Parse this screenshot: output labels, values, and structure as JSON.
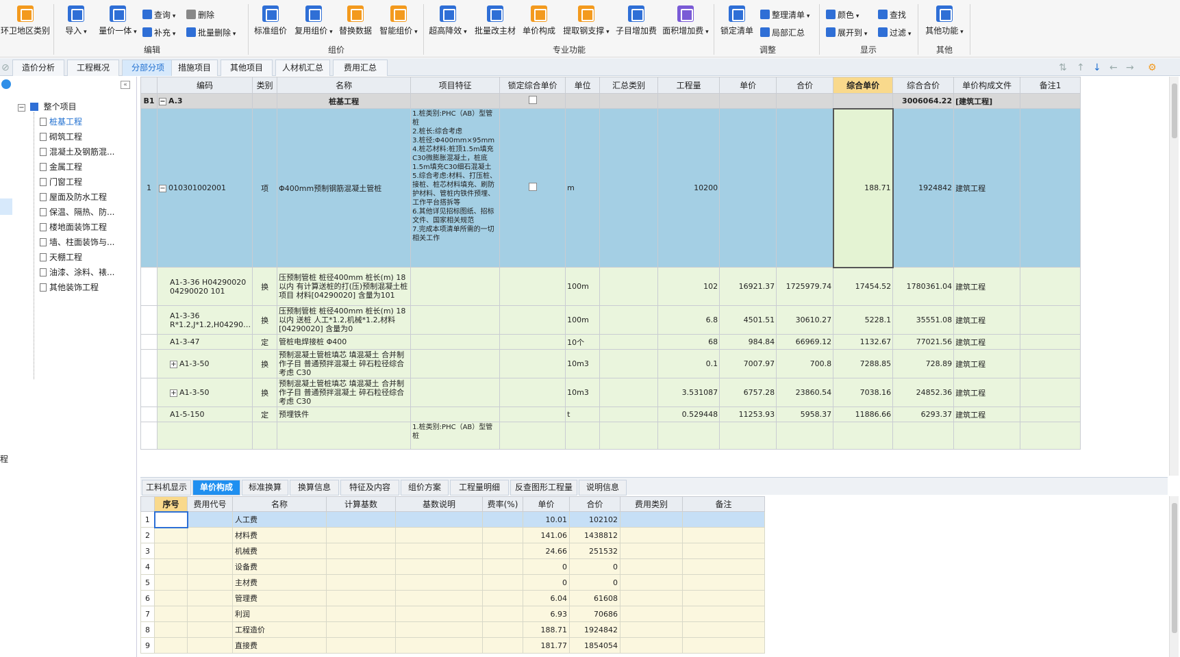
{
  "ribbon": {
    "big_buttons": [
      {
        "label": "环卫地区类别",
        "icon": "region-category-icon"
      },
      {
        "label": "导入",
        "icon": "import-icon"
      },
      {
        "label": "量价一体",
        "icon": "quantity-price-icon"
      },
      {
        "label": "标准组价",
        "icon": "standard-pricing-icon"
      },
      {
        "label": "复用组价",
        "icon": "reuse-pricing-icon"
      },
      {
        "label": "替换数据",
        "icon": "replace-data-icon"
      },
      {
        "label": "智能组价",
        "icon": "smart-pricing-icon"
      },
      {
        "label": "超高降效",
        "icon": "super-height-icon"
      },
      {
        "label": "批量改主材",
        "icon": "batch-material-icon"
      },
      {
        "label": "单价构成",
        "icon": "unit-price-icon"
      },
      {
        "label": "提取钢支撑",
        "icon": "steel-support-icon"
      },
      {
        "label": "子目增加费",
        "icon": "sub-item-fee-icon"
      },
      {
        "label": "面积增加费",
        "icon": "area-fee-icon"
      },
      {
        "label": "锁定清单",
        "icon": "lock-list-icon"
      },
      {
        "label": "其他功能",
        "icon": "other-functions-icon"
      }
    ],
    "small_buttons": {
      "query": "查询",
      "delete": "删除",
      "supplement": "补充",
      "batch_delete": "批量删除",
      "organize_list": "整理清单",
      "partial_summary": "局部汇总",
      "color": "颜色",
      "find": "查找",
      "expand_to": "展开到",
      "filter": "过滤"
    },
    "groups": {
      "edit": "编辑",
      "pricing": "组价",
      "professional": "专业功能",
      "adjust": "调整",
      "display": "显示",
      "other": "其他"
    }
  },
  "tabs": [
    "造价分析",
    "工程概况",
    "分部分项",
    "措施项目",
    "其他项目",
    "人材机汇总",
    "费用汇总"
  ],
  "active_tab": "分部分项",
  "tree": {
    "root": "整个项目",
    "items": [
      "桩基工程",
      "砌筑工程",
      "混凝土及钢筋混...",
      "金属工程",
      "门窗工程",
      "屋面及防水工程",
      "保温、隔热、防...",
      "楼地面装饰工程",
      "墙、柱面装饰与...",
      "天棚工程",
      "油漆、涂料、裱...",
      "其他装饰工程"
    ],
    "selected": "桩基工程",
    "left_edge_label": "程"
  },
  "grid": {
    "columns": [
      "编码",
      "类别",
      "名称",
      "项目特征",
      "锁定综合单价",
      "单位",
      "汇总类别",
      "工程量",
      "单价",
      "合价",
      "综合单价",
      "综合合价",
      "单价构成文件",
      "备注1"
    ],
    "section": {
      "row_no": "B1",
      "code": "A.3",
      "name": "桩基工程",
      "total": "3006064.22",
      "file": "[建筑工程]"
    },
    "main_row": {
      "row_no": "1",
      "code": "010301002001",
      "type": "项",
      "name": "Φ400mm预制钢筋混凝土管桩",
      "feature": "1.桩类别:PHC（AB）型管桩\n2.桩长:综合考虑\n3.桩径:Φ400mm×95mm\n4.桩芯材料:桩顶1.5m填充C30微膨胀混凝土，桩底1.5m填充C30细石混凝土\n5.综合考虑:材料、打压桩、接桩、桩芯材料填充、刷防护材料、管桩内铁件预埋、工作平台搭拆等\n6.其他详见招标图纸、招标文件、国家相关规范\n7.完成本项清单所需的一切相关工作",
      "unit": "m",
      "quantity": "10200",
      "composite_price": "188.71",
      "composite_total": "1924842",
      "file": "建筑工程"
    },
    "sub_rows": [
      {
        "code": "A1-3-36 H04290020 04290020 101",
        "type": "换",
        "name": "压预制管桩 桩径400mm 桩长(m) 18以内  有计算送桩的打(压)预制混凝土桩项目 材料[04290020] 含量为101",
        "unit": "100m",
        "quantity": "102",
        "price": "16921.37",
        "total": "1725979.74",
        "composite_price": "17454.52",
        "composite_total": "1780361.04",
        "file": "建筑工程",
        "expander": ""
      },
      {
        "code": "A1-3-36 R*1.2,J*1.2,H04290…",
        "type": "换",
        "name": "压预制管桩 桩径400mm 桩长(m) 18以内  送桩 人工*1.2,机械*1.2,材料[04290020] 含量为0",
        "unit": "100m",
        "quantity": "6.8",
        "price": "4501.51",
        "total": "30610.27",
        "composite_price": "5228.1",
        "composite_total": "35551.08",
        "file": "建筑工程",
        "expander": ""
      },
      {
        "code": "A1-3-47",
        "type": "定",
        "name": "管桩电焊接桩 Φ400",
        "unit": "10个",
        "quantity": "68",
        "price": "984.84",
        "total": "66969.12",
        "composite_price": "1132.67",
        "composite_total": "77021.56",
        "file": "建筑工程",
        "expander": ""
      },
      {
        "code": "A1-3-50",
        "type": "换",
        "name": "预制混凝土管桩填芯 填混凝土  合并制作子目 普通预拌混凝土 碎石粒径综合考虑 C30",
        "unit": "10m3",
        "quantity": "0.1",
        "price": "7007.97",
        "total": "700.8",
        "composite_price": "7288.85",
        "composite_total": "728.89",
        "file": "建筑工程",
        "expander": "+"
      },
      {
        "code": "A1-3-50",
        "type": "换",
        "name": "预制混凝土管桩填芯 填混凝土  合并制作子目 普通预拌混凝土 碎石粒径综合考虑 C30",
        "unit": "10m3",
        "quantity": "3.531087",
        "price": "6757.28",
        "total": "23860.54",
        "composite_price": "7038.16",
        "composite_total": "24852.36",
        "file": "建筑工程",
        "expander": "+"
      },
      {
        "code": "A1-5-150",
        "type": "定",
        "name": "预埋铁件",
        "unit": "t",
        "quantity": "0.529448",
        "price": "11253.93",
        "total": "5958.37",
        "composite_price": "11886.66",
        "composite_total": "6293.37",
        "file": "建筑工程",
        "expander": ""
      }
    ],
    "next_row_feature": "1.桩类别:PHC（AB）型管桩"
  },
  "bottom_tabs": [
    "工料机显示",
    "单价构成",
    "标准换算",
    "换算信息",
    "特征及内容",
    "组价方案",
    "工程量明细",
    "反查图形工程量",
    "说明信息"
  ],
  "active_bottom_tab": "单价构成",
  "bottom_grid": {
    "columns": [
      "序号",
      "费用代号",
      "名称",
      "计算基数",
      "基数说明",
      "费率(%)",
      "单价",
      "合价",
      "费用类别",
      "备注"
    ],
    "rows": [
      {
        "no": "1",
        "name": "人工费",
        "price": "10.01",
        "total": "102102"
      },
      {
        "no": "2",
        "name": "材料费",
        "price": "141.06",
        "total": "1438812"
      },
      {
        "no": "3",
        "name": "机械费",
        "price": "24.66",
        "total": "251532"
      },
      {
        "no": "4",
        "name": "设备费",
        "price": "0",
        "total": "0"
      },
      {
        "no": "5",
        "name": "主材费",
        "price": "0",
        "total": "0"
      },
      {
        "no": "6",
        "name": "管理费",
        "price": "6.04",
        "total": "61608"
      },
      {
        "no": "7",
        "name": "利润",
        "price": "6.93",
        "total": "70686"
      },
      {
        "no": "8",
        "name": "工程造价",
        "price": "188.71",
        "total": "1924842"
      },
      {
        "no": "9",
        "name": "直接费",
        "price": "181.77",
        "total": "1854054"
      }
    ]
  }
}
